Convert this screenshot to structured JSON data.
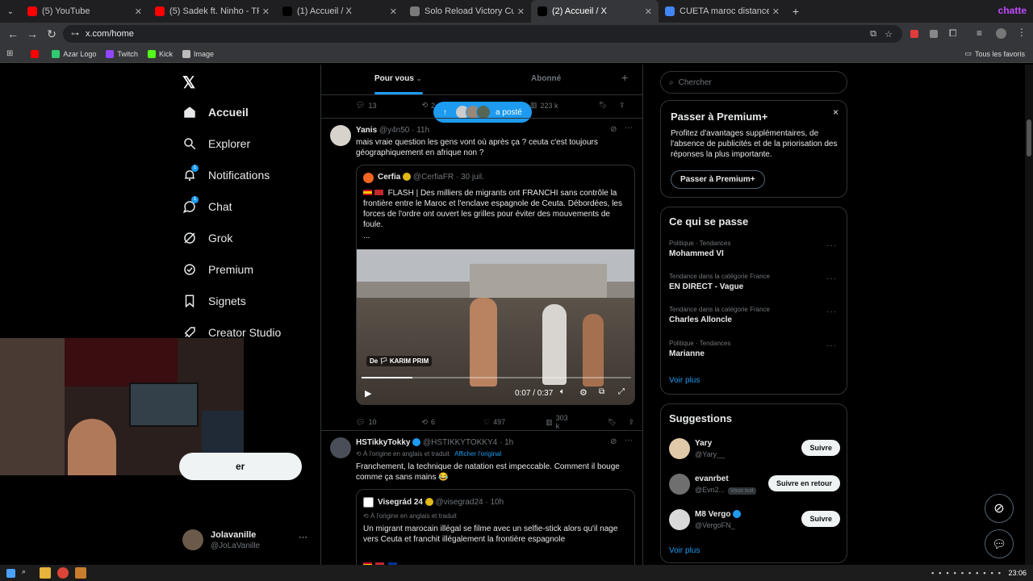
{
  "browser": {
    "tabs": [
      {
        "title": "(5) YouTube",
        "color": "#ff0000",
        "active": false
      },
      {
        "title": "(5) Sadek ft. Ninho - TP (Vidéo",
        "color": "#ff0000",
        "active": false
      },
      {
        "title": "(1) Accueil / X",
        "color": "#000000",
        "active": false
      },
      {
        "title": "Solo Reload Victory Cup in Euro",
        "color": "#7a7a7a",
        "active": false
      },
      {
        "title": "(2) Accueil / X",
        "color": "#000000",
        "active": true
      },
      {
        "title": "CUETA maroc distance - Recher",
        "color": "#4285f4",
        "active": false
      }
    ],
    "url": "x.com/home",
    "bookmarks": [
      {
        "label": "",
        "color": "#ff0000"
      },
      {
        "label": "Azar Logo",
        "color": "#2ecc71"
      },
      {
        "label": "Twitch",
        "color": "#9146ff"
      },
      {
        "label": "Kick",
        "color": "#53fc18"
      },
      {
        "label": "Image",
        "color": "#bbbbbb"
      }
    ],
    "all_bookmarks": "Tous les favoris",
    "profile_label": "chatte"
  },
  "nav": {
    "items": [
      {
        "label": "Accueil",
        "icon": "home-icon",
        "badge": ""
      },
      {
        "label": "Explorer",
        "icon": "search-icon",
        "badge": ""
      },
      {
        "label": "Notifications",
        "icon": "bell-icon",
        "badge": "1"
      },
      {
        "label": "Chat",
        "icon": "chat-icon",
        "badge": "1"
      },
      {
        "label": "Grok",
        "icon": "grok-icon",
        "badge": ""
      },
      {
        "label": "Premium",
        "icon": "premium-icon",
        "badge": ""
      },
      {
        "label": "Signets",
        "icon": "bookmark-icon",
        "badge": ""
      },
      {
        "label": "Creator Studio",
        "icon": "rocket-icon",
        "badge": ""
      }
    ],
    "post_button": "er",
    "account": {
      "name": "Jolavanille",
      "handle": "@JoLaVanille"
    }
  },
  "feed": {
    "tabs": {
      "for_you": "Pour vous",
      "following": "Abonné"
    },
    "posted_pill": "a posté",
    "prev_actions": {
      "replies": "13",
      "reposts": "2",
      "views": "223 k"
    },
    "tweet1": {
      "name": "Yanis",
      "handle": "@y4n50",
      "time": "· 11h",
      "text": "mais vraie question les gens vont où après ça ? ceuta c'est toujours géographiquement en afrique non ?",
      "quote": {
        "name": "Cerfia",
        "handle": "@CerfiaFR",
        "time": "· 30 juil.",
        "text": "FLASH | Des milliers de migrants ont FRANCHI sans contrôle la frontière entre le Maroc et l'enclave espagnole de Ceuta. Débordées, les forces de l'ordre ont ouvert les grilles pour éviter des mouvements de foule.",
        "ellipsis": "...",
        "video_credit": "De 🏳 KARIM PRIM",
        "video_time": "0:07 / 0:37",
        "progress": 0.19
      },
      "actions": {
        "replies": "10",
        "reposts": "6",
        "likes": "497",
        "views": "303 k"
      }
    },
    "tweet2": {
      "name": "HSTikkyTokky",
      "handle": "@HSTIKKYTOKKY4",
      "time": "· 1h",
      "translated": "À l'origine en anglais et traduit",
      "show_original": "Afficher l'original",
      "text": "Franchement, la technique de natation est impeccable. Comment il bouge comme ça sans mains 😂",
      "quote": {
        "name": "Visegrád 24",
        "handle": "@visegrad24",
        "time": "· 10h",
        "translated": "À l'origine en anglais et traduit",
        "text": "Un migrant marocain illégal se filme avec un selfie-stick alors qu'il nage vers Ceuta et franchit illégalement la frontière espagnole"
      }
    }
  },
  "right": {
    "search_placeholder": "Chercher",
    "premium": {
      "title": "Passer à Premium+",
      "text": "Profitez d'avantages supplémentaires, de l'absence de publicités et de la priorisation des réponses la plus importante.",
      "button": "Passer à Premium+"
    },
    "trends": {
      "title": "Ce qui se passe",
      "items": [
        {
          "category": "Politique · Tendances",
          "name": "Mohammed VI"
        },
        {
          "category": "Tendance dans la catégorie France",
          "name": "EN DIRECT - Vague"
        },
        {
          "category": "Tendance dans la catégorie France",
          "name": "Charles Alloncle"
        },
        {
          "category": "Politique · Tendances",
          "name": "Marianne"
        }
      ],
      "more": "Voir plus"
    },
    "suggestions": {
      "title": "Suggestions",
      "items": [
        {
          "name": "Yary",
          "handle": "@Yary__",
          "button": "Suivre",
          "follows_you": ""
        },
        {
          "name": "evanrbet",
          "handle": "@Evn2...",
          "button": "Suivre en retour",
          "follows_you": "Vous suit"
        },
        {
          "name": "M8 Vergo",
          "handle": "@VergoFN_",
          "button": "Suivre",
          "follows_you": ""
        }
      ],
      "more": "Voir plus"
    }
  },
  "taskbar": {
    "time": "23:06"
  },
  "colors": {
    "accent": "#1d9bf0",
    "background": "#000000",
    "border": "#2f3336"
  }
}
